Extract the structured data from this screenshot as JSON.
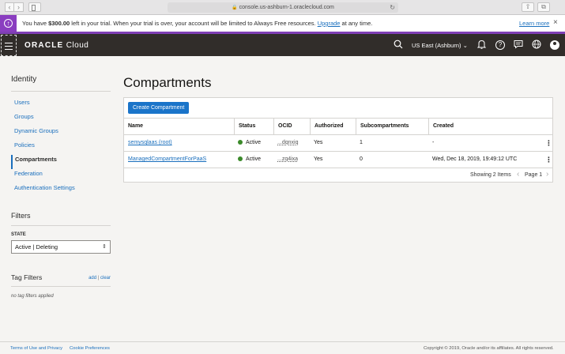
{
  "browser": {
    "url": "console.us-ashburn-1.oraclecloud.com"
  },
  "banner": {
    "prefix": "You have ",
    "amount": "$300.00",
    "suffix": " left in your trial. When your trial is over, your account will be limited to Always Free resources. ",
    "upgrade_link": "Upgrade",
    "tail": " at any time.",
    "learn_more": "Learn more"
  },
  "header": {
    "logo_brand": "ORACLE",
    "logo_product": " Cloud",
    "region": "US East (Ashburn)"
  },
  "sidebar": {
    "title": "Identity",
    "items": [
      {
        "label": "Users"
      },
      {
        "label": "Groups"
      },
      {
        "label": "Dynamic Groups"
      },
      {
        "label": "Policies"
      },
      {
        "label": "Compartments"
      },
      {
        "label": "Federation"
      },
      {
        "label": "Authentication Settings"
      }
    ]
  },
  "filters": {
    "title": "Filters",
    "state_label": "STATE",
    "state_value": "Active | Deleting"
  },
  "tag_filters": {
    "title": "Tag Filters",
    "add": "add",
    "separator": " | ",
    "clear": "clear",
    "empty": "no tag filters applied"
  },
  "main": {
    "title": "Compartments",
    "create_button": "Create Compartment",
    "columns": [
      "Name",
      "Status",
      "OCID",
      "Authorized",
      "Subcompartments",
      "Created"
    ],
    "rows": [
      {
        "name": "semysqlaas (root)",
        "status": "Active",
        "ocid": "...dqnxiq",
        "authorized": "Yes",
        "subcompartments": "1",
        "created": "-"
      },
      {
        "name": "ManagedCompartmentForPaaS",
        "status": "Active",
        "ocid": "...zq4ixa",
        "authorized": "Yes",
        "subcompartments": "0",
        "created": "Wed, Dec 18, 2019, 19:49:12 UTC"
      }
    ],
    "showing": "Showing 2 Items",
    "page": "Page 1"
  },
  "footer": {
    "terms": "Terms of Use and Privacy",
    "cookies": "Cookie Preferences",
    "copyright": "Copyright © 2019, Oracle and/or its affiliates. All rights reserved."
  },
  "colors": {
    "header_bg": "#312d2a",
    "link": "#1a6fbd",
    "primary_button": "#1a74c9",
    "banner_accent": "#8a3ec0",
    "active_status": "#3b8a2a"
  },
  "icons": [
    "back-icon",
    "forward-icon",
    "sidebar-icon",
    "lock-icon",
    "reload-icon",
    "share-icon",
    "tabs-icon",
    "upgrade-icon",
    "close-icon",
    "menu-icon",
    "search-icon",
    "chevron-down-icon",
    "bell-icon",
    "help-icon",
    "chat-icon",
    "globe-icon",
    "user-icon",
    "kebab-icon",
    "chevron-left-icon",
    "chevron-right-icon"
  ]
}
